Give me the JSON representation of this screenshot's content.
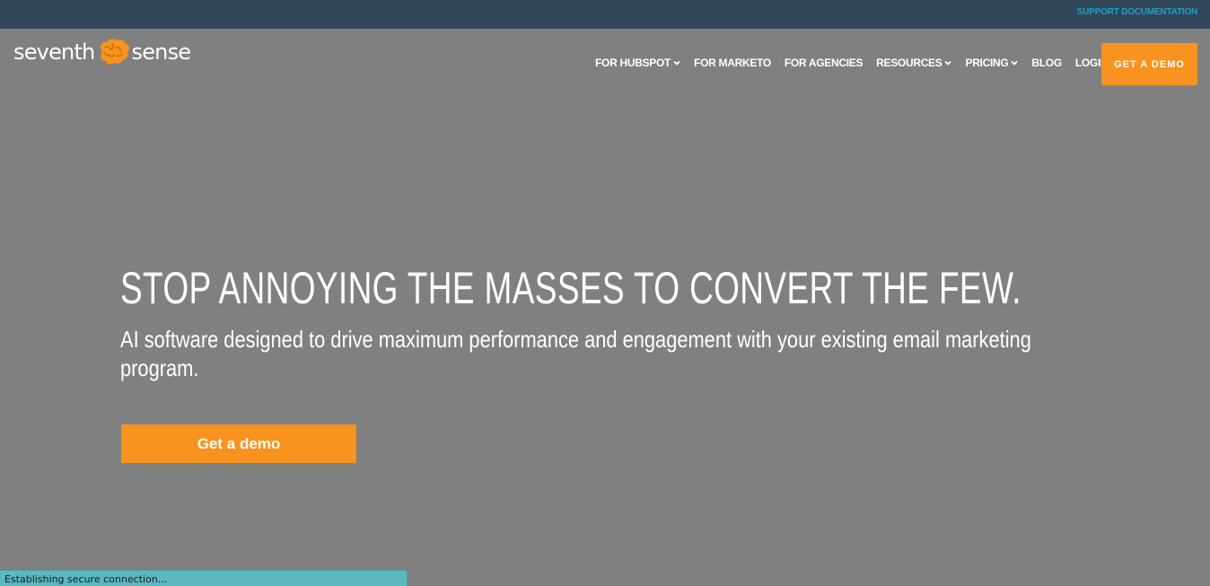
{
  "topbar": {
    "support_link": "SUPPORT DOCUMENTATION",
    "bg_color": "#33475b",
    "link_color": "#1aa0c6"
  },
  "logo": {
    "left_word": "seventh",
    "right_word": "sense",
    "icon": "brain-icon",
    "icon_color": "#f7931e"
  },
  "nav": {
    "items": [
      {
        "label": "FOR HUBSPOT",
        "dropdown": true
      },
      {
        "label": "FOR MARKETO",
        "dropdown": false
      },
      {
        "label": "FOR AGENCIES",
        "dropdown": false
      },
      {
        "label": "RESOURCES",
        "dropdown": true
      },
      {
        "label": "PRICING",
        "dropdown": true
      },
      {
        "label": "BLOG",
        "dropdown": false
      },
      {
        "label": "LOGIN",
        "dropdown": false
      }
    ],
    "cta_label": "GET A DEMO"
  },
  "hero": {
    "title": "STOP ANNOYING THE MASSES TO CONVERT THE FEW.",
    "subtitle": "AI software designed to drive maximum performance and engagement with your existing email marketing program.",
    "cta_label": "Get a demo",
    "accent_color": "#f7931e"
  },
  "status_bar": {
    "text": "Establishing secure connection..."
  }
}
